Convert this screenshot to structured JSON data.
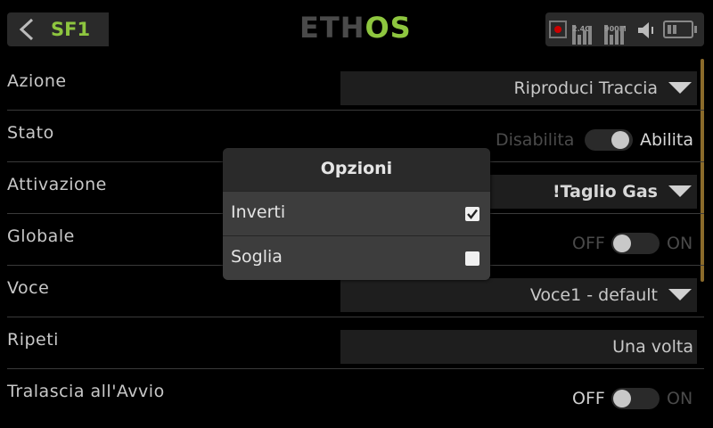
{
  "header": {
    "title": "SF1",
    "logo_prefix": "ETH",
    "logo_suffix": "OS",
    "signal1_label": "2.4G",
    "signal2_label": "900M"
  },
  "rows": [
    {
      "label": "Azione",
      "value": "Riproduci Traccia"
    },
    {
      "label": "Stato",
      "off": "Disabilita",
      "on": "Abilita"
    },
    {
      "label": "Attivazione",
      "value": "!Taglio Gas"
    },
    {
      "label": "Globale",
      "off": "OFF",
      "on": "ON"
    },
    {
      "label": "Voce",
      "value": "Voce1 - default"
    },
    {
      "label": "Ripeti",
      "value": "Una volta"
    },
    {
      "label": "Tralascia all'Avvio",
      "off": "OFF",
      "on": "ON"
    }
  ],
  "dialog": {
    "title": "Opzioni",
    "items": [
      {
        "label": "Inverti",
        "checked": true
      },
      {
        "label": "Soglia",
        "checked": false
      }
    ]
  },
  "colors": {
    "accent": "#8ec63f",
    "scrollbar": "#8a6a2a"
  }
}
